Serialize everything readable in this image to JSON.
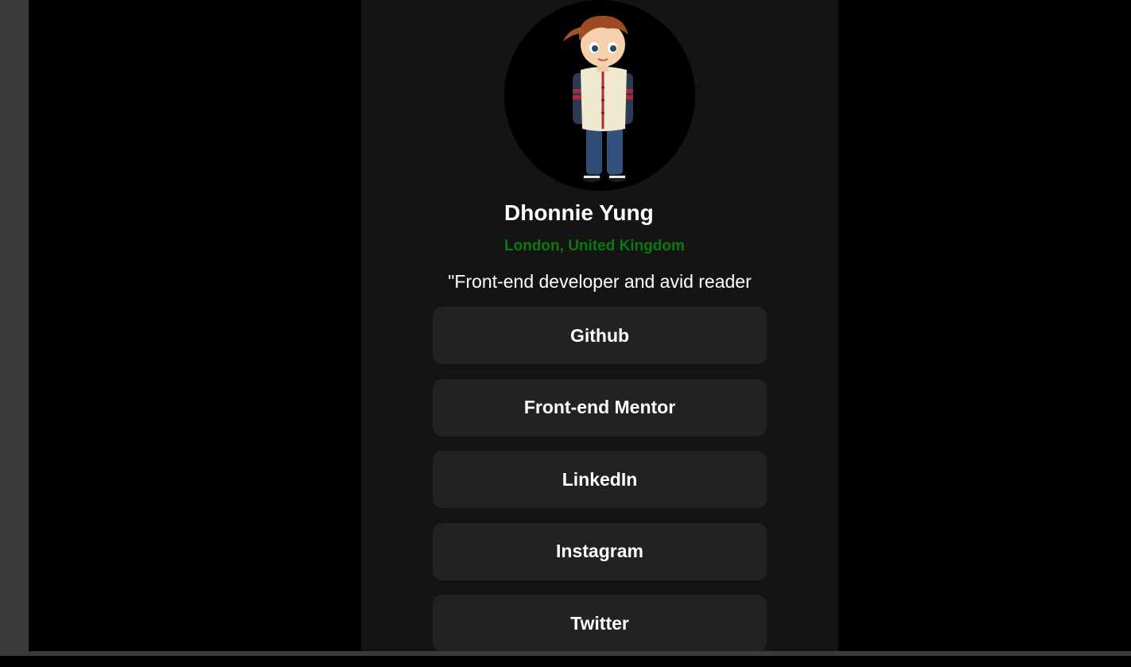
{
  "profile": {
    "avatar_icon": "cartoon-boy-avatar",
    "name": "Dhonnie Yung",
    "location": "London, United Kingdom",
    "bio": "\"Front-end developer and avid reader",
    "accent_color": "#0b7a0b"
  },
  "links": [
    {
      "label": "Github"
    },
    {
      "label": "Front-end Mentor"
    },
    {
      "label": "LinkedIn"
    },
    {
      "label": "Instagram"
    },
    {
      "label": "Twitter"
    }
  ]
}
